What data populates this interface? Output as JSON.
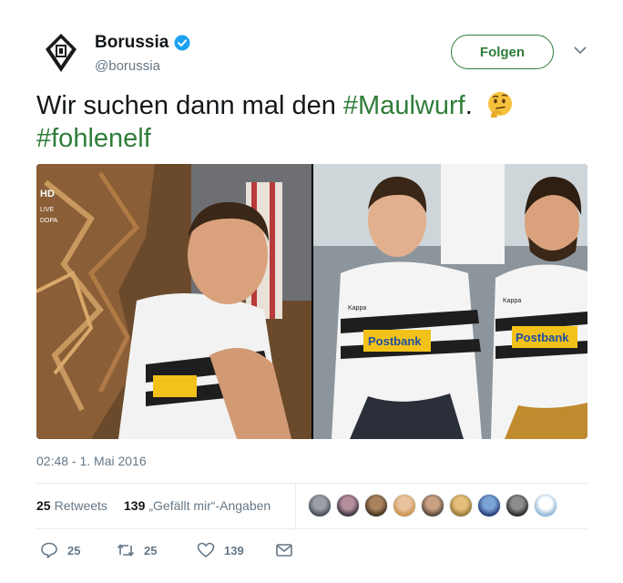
{
  "account": {
    "display_name": "Borussia",
    "handle": "@borussia",
    "verified": true,
    "follow_label": "Folgen",
    "brand_color": "#2f7d3a"
  },
  "tweet": {
    "text_plain": "Wir suchen dann mal den",
    "hashtag1": "#Maulwurf",
    "after_hashtag1": ".",
    "emoji": "thinking-face-icon",
    "hashtag2": "#fohlenelf",
    "timestamp": "02:48 - 1. Mai 2016"
  },
  "media": {
    "left_photo_overlay": [
      "HD",
      "LIVE",
      "DOPA"
    ],
    "shirt_sponsor": "Postbank",
    "shirt_brand": "Kappa"
  },
  "stats": {
    "retweets_count": "25",
    "retweets_label": "Retweets",
    "likes_count": "139",
    "likes_label": "„Gefällt mir“-Angaben",
    "liker_avatars": 9
  },
  "actions": {
    "reply_count": "25",
    "retweet_count": "25",
    "like_count": "139"
  }
}
